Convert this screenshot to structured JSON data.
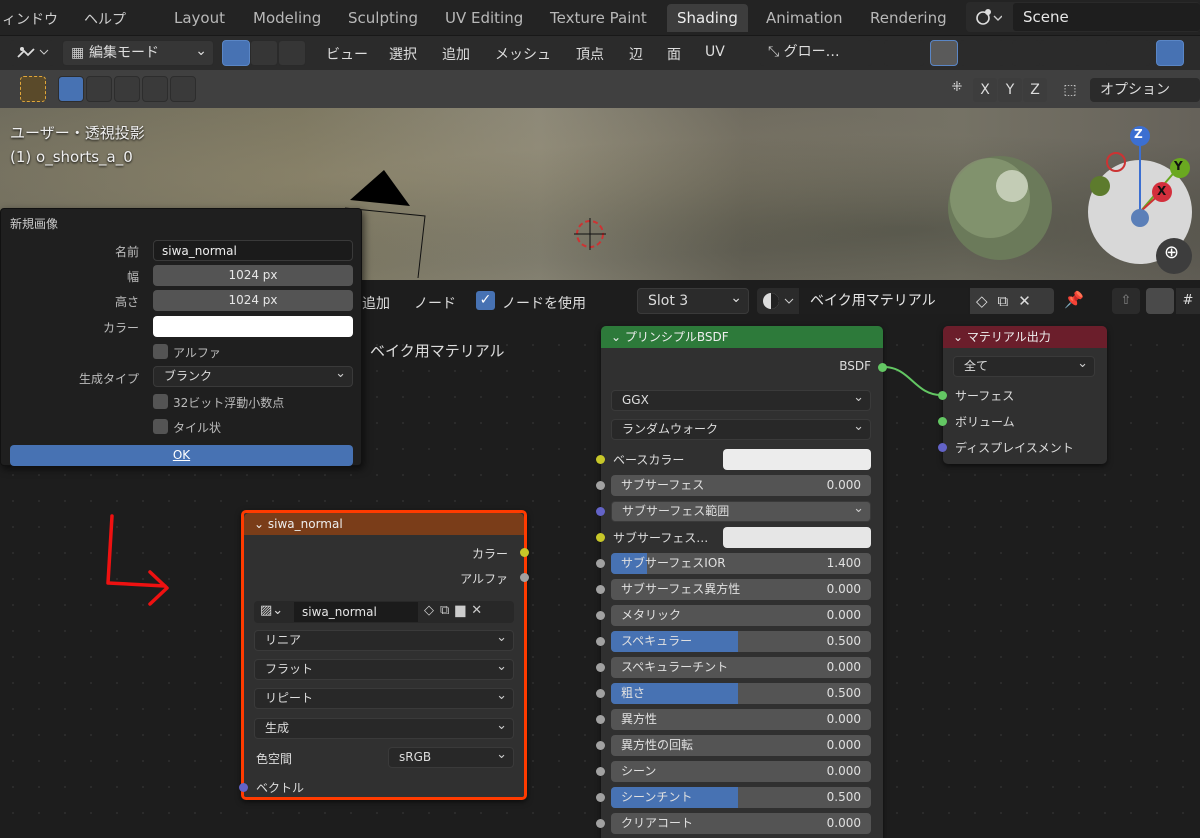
{
  "topbar": {
    "menu_window": "ィンドウ",
    "menu_help": "ヘルプ",
    "tabs": [
      "Layout",
      "Modeling",
      "Sculpting",
      "UV Editing",
      "Texture Paint",
      "Shading",
      "Animation",
      "Rendering"
    ],
    "active_tab": "Shading",
    "scene_label": "Scene"
  },
  "header2": {
    "mode": "編集モード",
    "menus": [
      "ビュー",
      "選択",
      "追加",
      "メッシュ",
      "頂点",
      "辺",
      "面",
      "UV"
    ],
    "transform": "グロー…"
  },
  "header3": {
    "axes": [
      "X",
      "Y",
      "Z"
    ],
    "options": "オプション"
  },
  "viewport": {
    "projection": "ユーザー・透視投影",
    "object": "(1) o_shorts_a_0",
    "gizmo": {
      "z": "Z",
      "y": "Y",
      "x": "X"
    }
  },
  "popup": {
    "title": "新規画像",
    "name_label": "名前",
    "name_value": "siwa_normal",
    "width_label": "幅",
    "width_value": "1024 px",
    "height_label": "高さ",
    "height_value": "1024 px",
    "color_label": "カラー",
    "alpha_label": "アルファ",
    "gen_type_label": "生成タイプ",
    "gen_type_value": "ブランク",
    "float_label": "32ビット浮動小数点",
    "tiled_label": "タイル状",
    "ok_label": "OK"
  },
  "node_header": {
    "add": "追加",
    "node": "ノード",
    "use_nodes": "ノードを使用",
    "slot": "Slot 3",
    "material": "ベイク用マテリアル"
  },
  "canvas_label": "ベイク用マテリアル",
  "image_node": {
    "title": "siwa_normal",
    "out_color": "カラー",
    "out_alpha": "アルファ",
    "image_name": "siwa_normal",
    "interpolation": "リニア",
    "projection": "フラット",
    "extension": "リピート",
    "source": "生成",
    "colorspace_label": "色空間",
    "colorspace_value": "sRGB",
    "vector_label": "ベクトル"
  },
  "bsdf_node": {
    "title": "プリンシプルBSDF",
    "out": "BSDF",
    "distribution": "GGX",
    "subsurface_method": "ランダムウォーク",
    "base_color": "ベースカラー",
    "rows": [
      {
        "label": "サブサーフェス",
        "value": "0.000",
        "fill": 0
      },
      {
        "label": "サブサーフェス範囲",
        "value": "",
        "dropdown": true
      },
      {
        "label": "サブサーフェス…",
        "value": "",
        "color": true
      },
      {
        "label": "サブサーフェスIOR",
        "value": "1.400",
        "fill": 0.14
      },
      {
        "label": "サブサーフェス異方性",
        "value": "0.000",
        "fill": 0
      },
      {
        "label": "メタリック",
        "value": "0.000",
        "fill": 0
      },
      {
        "label": "スペキュラー",
        "value": "0.500",
        "fill": 0.5
      },
      {
        "label": "スペキュラーチント",
        "value": "0.000",
        "fill": 0
      },
      {
        "label": "粗さ",
        "value": "0.500",
        "fill": 0.5
      },
      {
        "label": "異方性",
        "value": "0.000",
        "fill": 0
      },
      {
        "label": "異方性の回転",
        "value": "0.000",
        "fill": 0
      },
      {
        "label": "シーン",
        "value": "0.000",
        "fill": 0
      },
      {
        "label": "シーンチント",
        "value": "0.500",
        "fill": 0.5
      },
      {
        "label": "クリアコート",
        "value": "0.000",
        "fill": 0
      }
    ]
  },
  "output_node": {
    "title": "マテリアル出力",
    "target": "全て",
    "surface": "サーフェス",
    "volume": "ボリューム",
    "displacement": "ディスプレイスメント"
  },
  "colors": {
    "accent": "#4772b3",
    "bsdf_header": "#2d7a3a",
    "output_header": "#6b1e2b",
    "image_header": "#7a3d19",
    "highlight": "#ff3b00"
  }
}
